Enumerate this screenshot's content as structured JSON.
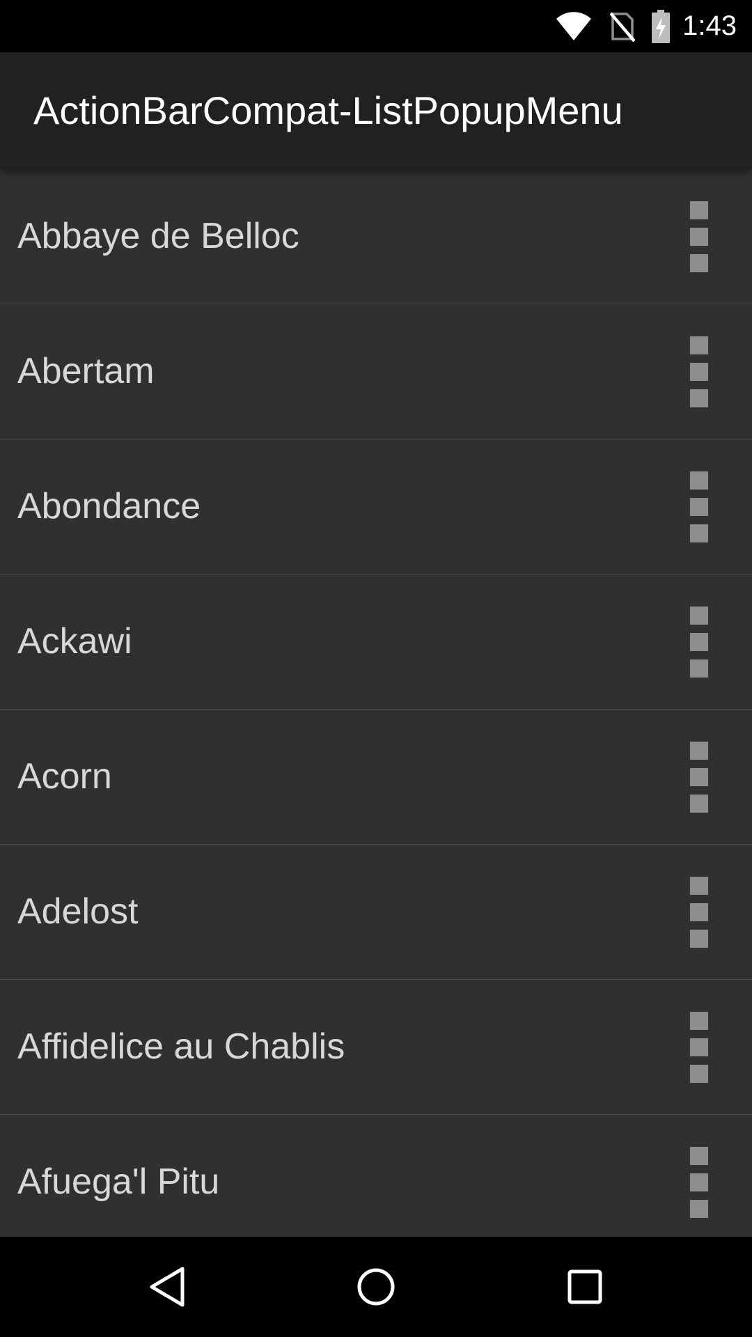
{
  "status_bar": {
    "time": "1:43",
    "icons": [
      "wifi-icon",
      "no-sim-icon",
      "battery-charging-icon"
    ]
  },
  "action_bar": {
    "title": "ActionBarCompat-ListPopupMenu"
  },
  "list": {
    "items": [
      {
        "label": "Abbaye de Belloc",
        "menu_icon": "overflow-menu-icon"
      },
      {
        "label": "Abertam",
        "menu_icon": "overflow-menu-icon"
      },
      {
        "label": "Abondance",
        "menu_icon": "overflow-menu-icon"
      },
      {
        "label": "Ackawi",
        "menu_icon": "overflow-menu-icon"
      },
      {
        "label": "Acorn",
        "menu_icon": "overflow-menu-icon"
      },
      {
        "label": "Adelost",
        "menu_icon": "overflow-menu-icon"
      },
      {
        "label": "Affidelice au Chablis",
        "menu_icon": "overflow-menu-icon"
      },
      {
        "label": "Afuega'l Pitu",
        "menu_icon": "overflow-menu-icon"
      }
    ]
  },
  "nav_bar": {
    "buttons": [
      "back-icon",
      "home-icon",
      "recents-icon"
    ]
  },
  "colors": {
    "status_bar_bg": "#000000",
    "action_bar_bg": "#212121",
    "list_bg": "#303030",
    "divider": "#4e4e4e",
    "item_text": "#d8d8d8",
    "overflow_icon": "#8d8d8d"
  }
}
